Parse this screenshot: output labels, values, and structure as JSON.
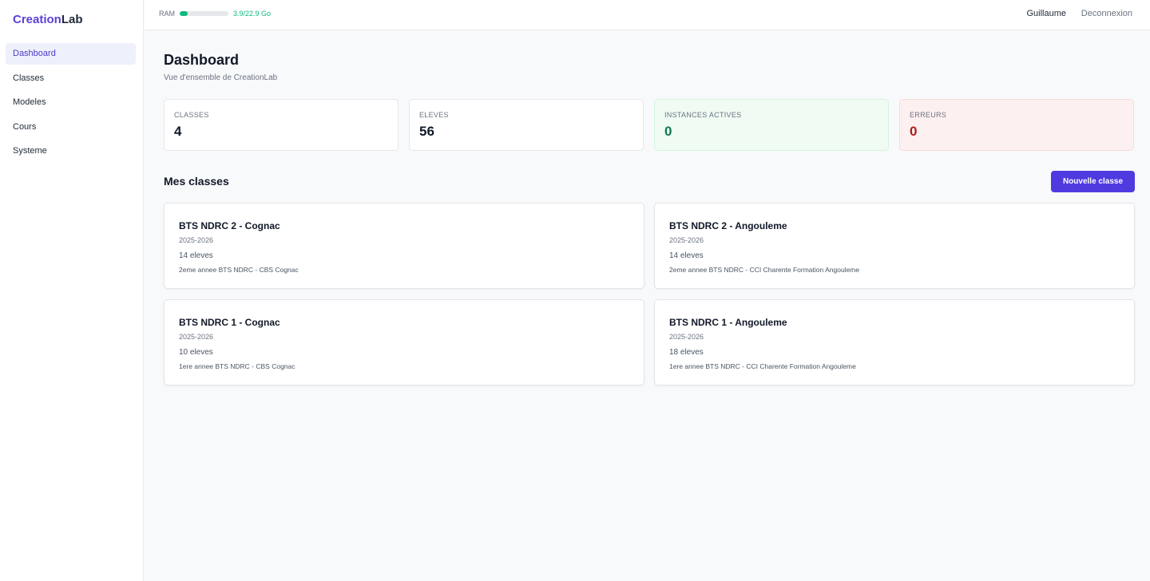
{
  "logo": {
    "part1": "Creation",
    "part2": "Lab"
  },
  "sidebar": {
    "items": [
      {
        "label": "Dashboard",
        "active": true
      },
      {
        "label": "Classes"
      },
      {
        "label": "Modeles"
      },
      {
        "label": "Cours"
      },
      {
        "label": "Systeme"
      }
    ]
  },
  "topbar": {
    "ram_label": "RAM",
    "ram_value": "3.9/22.9 Go",
    "ram_fraction": 0.17,
    "user": "Guillaume",
    "logout": "Deconnexion"
  },
  "page": {
    "title": "Dashboard",
    "subtitle": "Vue d'ensemble de CreationLab"
  },
  "stats": [
    {
      "label": "CLASSES",
      "value": "4"
    },
    {
      "label": "ELEVES",
      "value": "56"
    },
    {
      "label": "INSTANCES ACTIVES",
      "value": "0"
    },
    {
      "label": "ERREURS",
      "value": "0"
    }
  ],
  "classes_section": {
    "title": "Mes classes",
    "new_button": "Nouvelle classe"
  },
  "classes": [
    {
      "name": "BTS NDRC 2 - Cognac",
      "year": "2025-2026",
      "count": "14 eleves",
      "desc": "2eme annee BTS NDRC - CBS Cognac"
    },
    {
      "name": "BTS NDRC 2 - Angouleme",
      "year": "2025-2026",
      "count": "14 eleves",
      "desc": "2eme annee BTS NDRC - CCI Charente Formation Angouleme"
    },
    {
      "name": "BTS NDRC 1 - Cognac",
      "year": "2025-2026",
      "count": "10 eleves",
      "desc": "1ere annee BTS NDRC - CBS Cognac"
    },
    {
      "name": "BTS NDRC 1 - Angouleme",
      "year": "2025-2026",
      "count": "18 eleves",
      "desc": "1ere annee BTS NDRC - CCI Charente Formation Angouleme"
    }
  ],
  "colors": {
    "brand": "#5b3fd6",
    "button": "#4f3ae0",
    "ram": "#10b981",
    "success": "#0f7a4f",
    "error": "#b01c1c"
  }
}
